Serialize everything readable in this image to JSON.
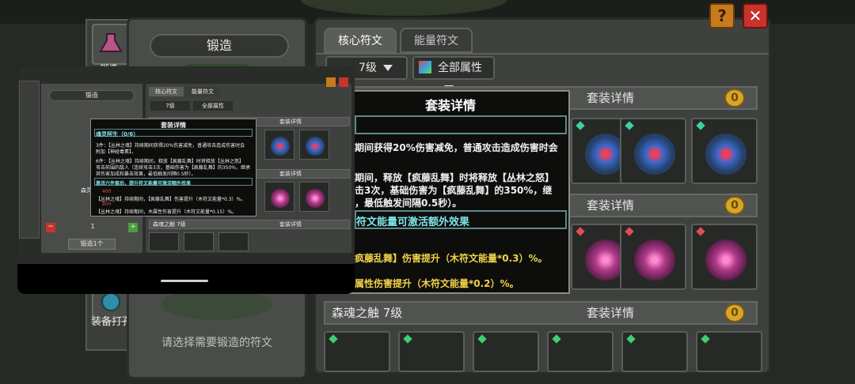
{
  "sidebar": {
    "item1_label": "锻造",
    "bottom_label": "装备打孔"
  },
  "forge": {
    "title": "锻造",
    "hint": "请选择需要锻造的符文"
  },
  "tabs": [
    {
      "label": "核心符文"
    },
    {
      "label": "能量符文"
    }
  ],
  "filters": {
    "level": "7级",
    "attribute": "全部属性"
  },
  "buttons": {
    "help": "?",
    "close": "✕"
  },
  "sections": [
    {
      "detail": "套装详情"
    },
    {
      "detail": "套装详情"
    },
    {
      "title": "森魂之触 7级",
      "detail": "套装详情"
    }
  ],
  "coin_symbol": "0",
  "popup": {
    "title": "套装详情",
    "line1": "期间获得20%伤害减免，普通攻击造成伤害时会",
    "line2": "期间，释放【疯藤乱舞】时将释放【丛林之怒】",
    "line3": "击3次，基础伤害为【疯藤乱舞】的350%，继",
    "line4": "，最低触发间隔0.5秒）。",
    "box2": "符文能量可激活额外效果",
    "effect1": "疯藤乱舞】伤害提升（木符文能量*0.3）%。",
    "effect2": "属性伤害提升（木符文能量*0.2）%。"
  },
  "mini": {
    "forge_title": "锻造",
    "tab1": "核心符文",
    "tab2": "能量符文",
    "level": "7级",
    "attr": "全部属性",
    "section_detail": "套装详情",
    "sec3_title": "森魂之触 7级",
    "qty": "1",
    "forge_btn": "锻造1个",
    "set_name": "森灵阿生",
    "popup_title": "套装详情",
    "set_header": "魂灵阿生（0/6）",
    "p3": "3件：【丛林之魂】持续期间获得20%伤害减免，普通攻击造成伤害时会",
    "p3b": "附加【神经毒素】。",
    "p6": "6件：【丛林之魂】持续期间，释放【疯藤乱舞】时将释放【丛林之怒】",
    "p6b": "攻击前围的敌人（连续攻击3次，基础伤害为【疯藤乱舞】的350%，继承",
    "p6c": "其伤害加成和暴击效果，最低触发间隔0.5秒）。",
    "box": "激活六件套后，提升符文能量可激活额外效果",
    "v400": "400",
    "e1": "【丛林之魂】持续期间，【疯藤乱舞】伤害提升（木符文能量*0.3）%。",
    "v800": "800",
    "e2": "【丛林之魂】持续期间，木属性伤害提升（木符文能量*0.15）%。"
  },
  "colors": {
    "accent_orange": "#c97a1e",
    "close_red": "#c9332b",
    "cyan": "#7fe4e8",
    "yellow": "#f2d24a"
  }
}
